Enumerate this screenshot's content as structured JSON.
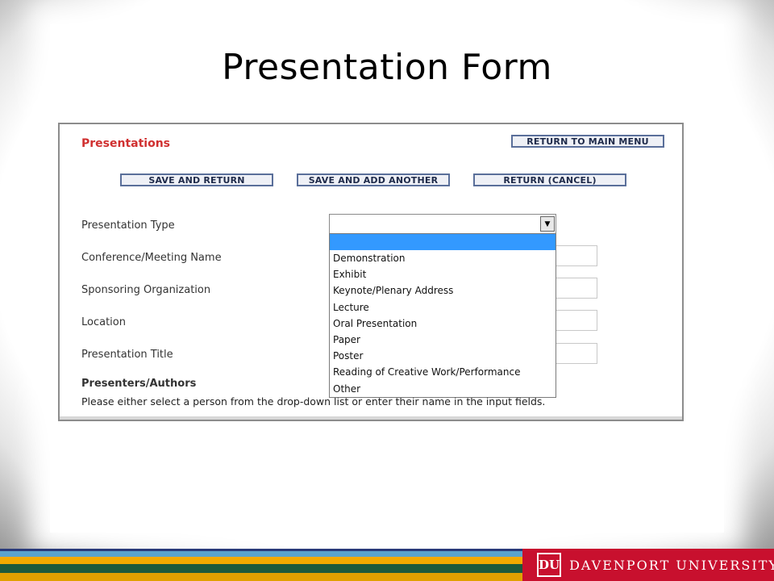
{
  "slide": {
    "title": "Presentation Form"
  },
  "form": {
    "section_title": "Presentations",
    "buttons": {
      "return_main": "RETURN TO MAIN MENU",
      "save_return": "SAVE AND RETURN",
      "save_add": "SAVE AND ADD ANOTHER",
      "cancel": "RETURN (CANCEL)"
    },
    "labels": {
      "presentation_type": "Presentation Type",
      "conference": "Conference/Meeting Name",
      "sponsor": "Sponsoring Organization",
      "location": "Location",
      "presentation_title": "Presentation Title",
      "presenters": "Presenters/Authors"
    },
    "instructions": "Please either select a person from the drop-down list or enter their name in the input fields.",
    "presentation_type": {
      "value": "",
      "options": [
        "",
        "Demonstration",
        "Exhibit",
        "Keynote/Plenary Address",
        "Lecture",
        "Oral Presentation",
        "Paper",
        "Poster",
        "Reading of Creative Work/Performance",
        "Other"
      ]
    }
  },
  "footer": {
    "logo_text": "DU",
    "university_name": "DAVENPORT UNIVERSITY"
  },
  "colors": {
    "section_title": "#d03030",
    "dropdown_highlight": "#3399ff",
    "brand_red": "#c8102e"
  }
}
